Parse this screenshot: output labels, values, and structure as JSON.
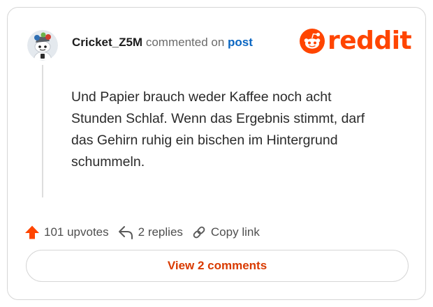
{
  "comment": {
    "username": "Cricket_Z5M",
    "action_text": "commented on",
    "post_link_label": "post",
    "body": "Und Papier brauch weder Kaffee noch acht Stunden Schlaf. Wenn das Ergebnis stimmt, darf das Gehirn ruhig ein bischen im Hintergrund schummeln."
  },
  "brand": {
    "logo_text": "reddit",
    "logo_color": "#ff4500"
  },
  "actions": {
    "upvotes_label": "101 upvotes",
    "replies_label": "2 replies",
    "copy_link_label": "Copy link"
  },
  "footer": {
    "view_comments_label": "View 2 comments"
  },
  "icons": {
    "avatar": "snoo-avatar",
    "logo": "snoo-logo-icon",
    "upvote": "upvote-arrow-icon",
    "reply": "reply-arrow-icon",
    "link": "chain-link-icon"
  },
  "colors": {
    "accent": "#ff4500",
    "link_blue": "#0a66c2",
    "button_text": "#d93a00"
  }
}
